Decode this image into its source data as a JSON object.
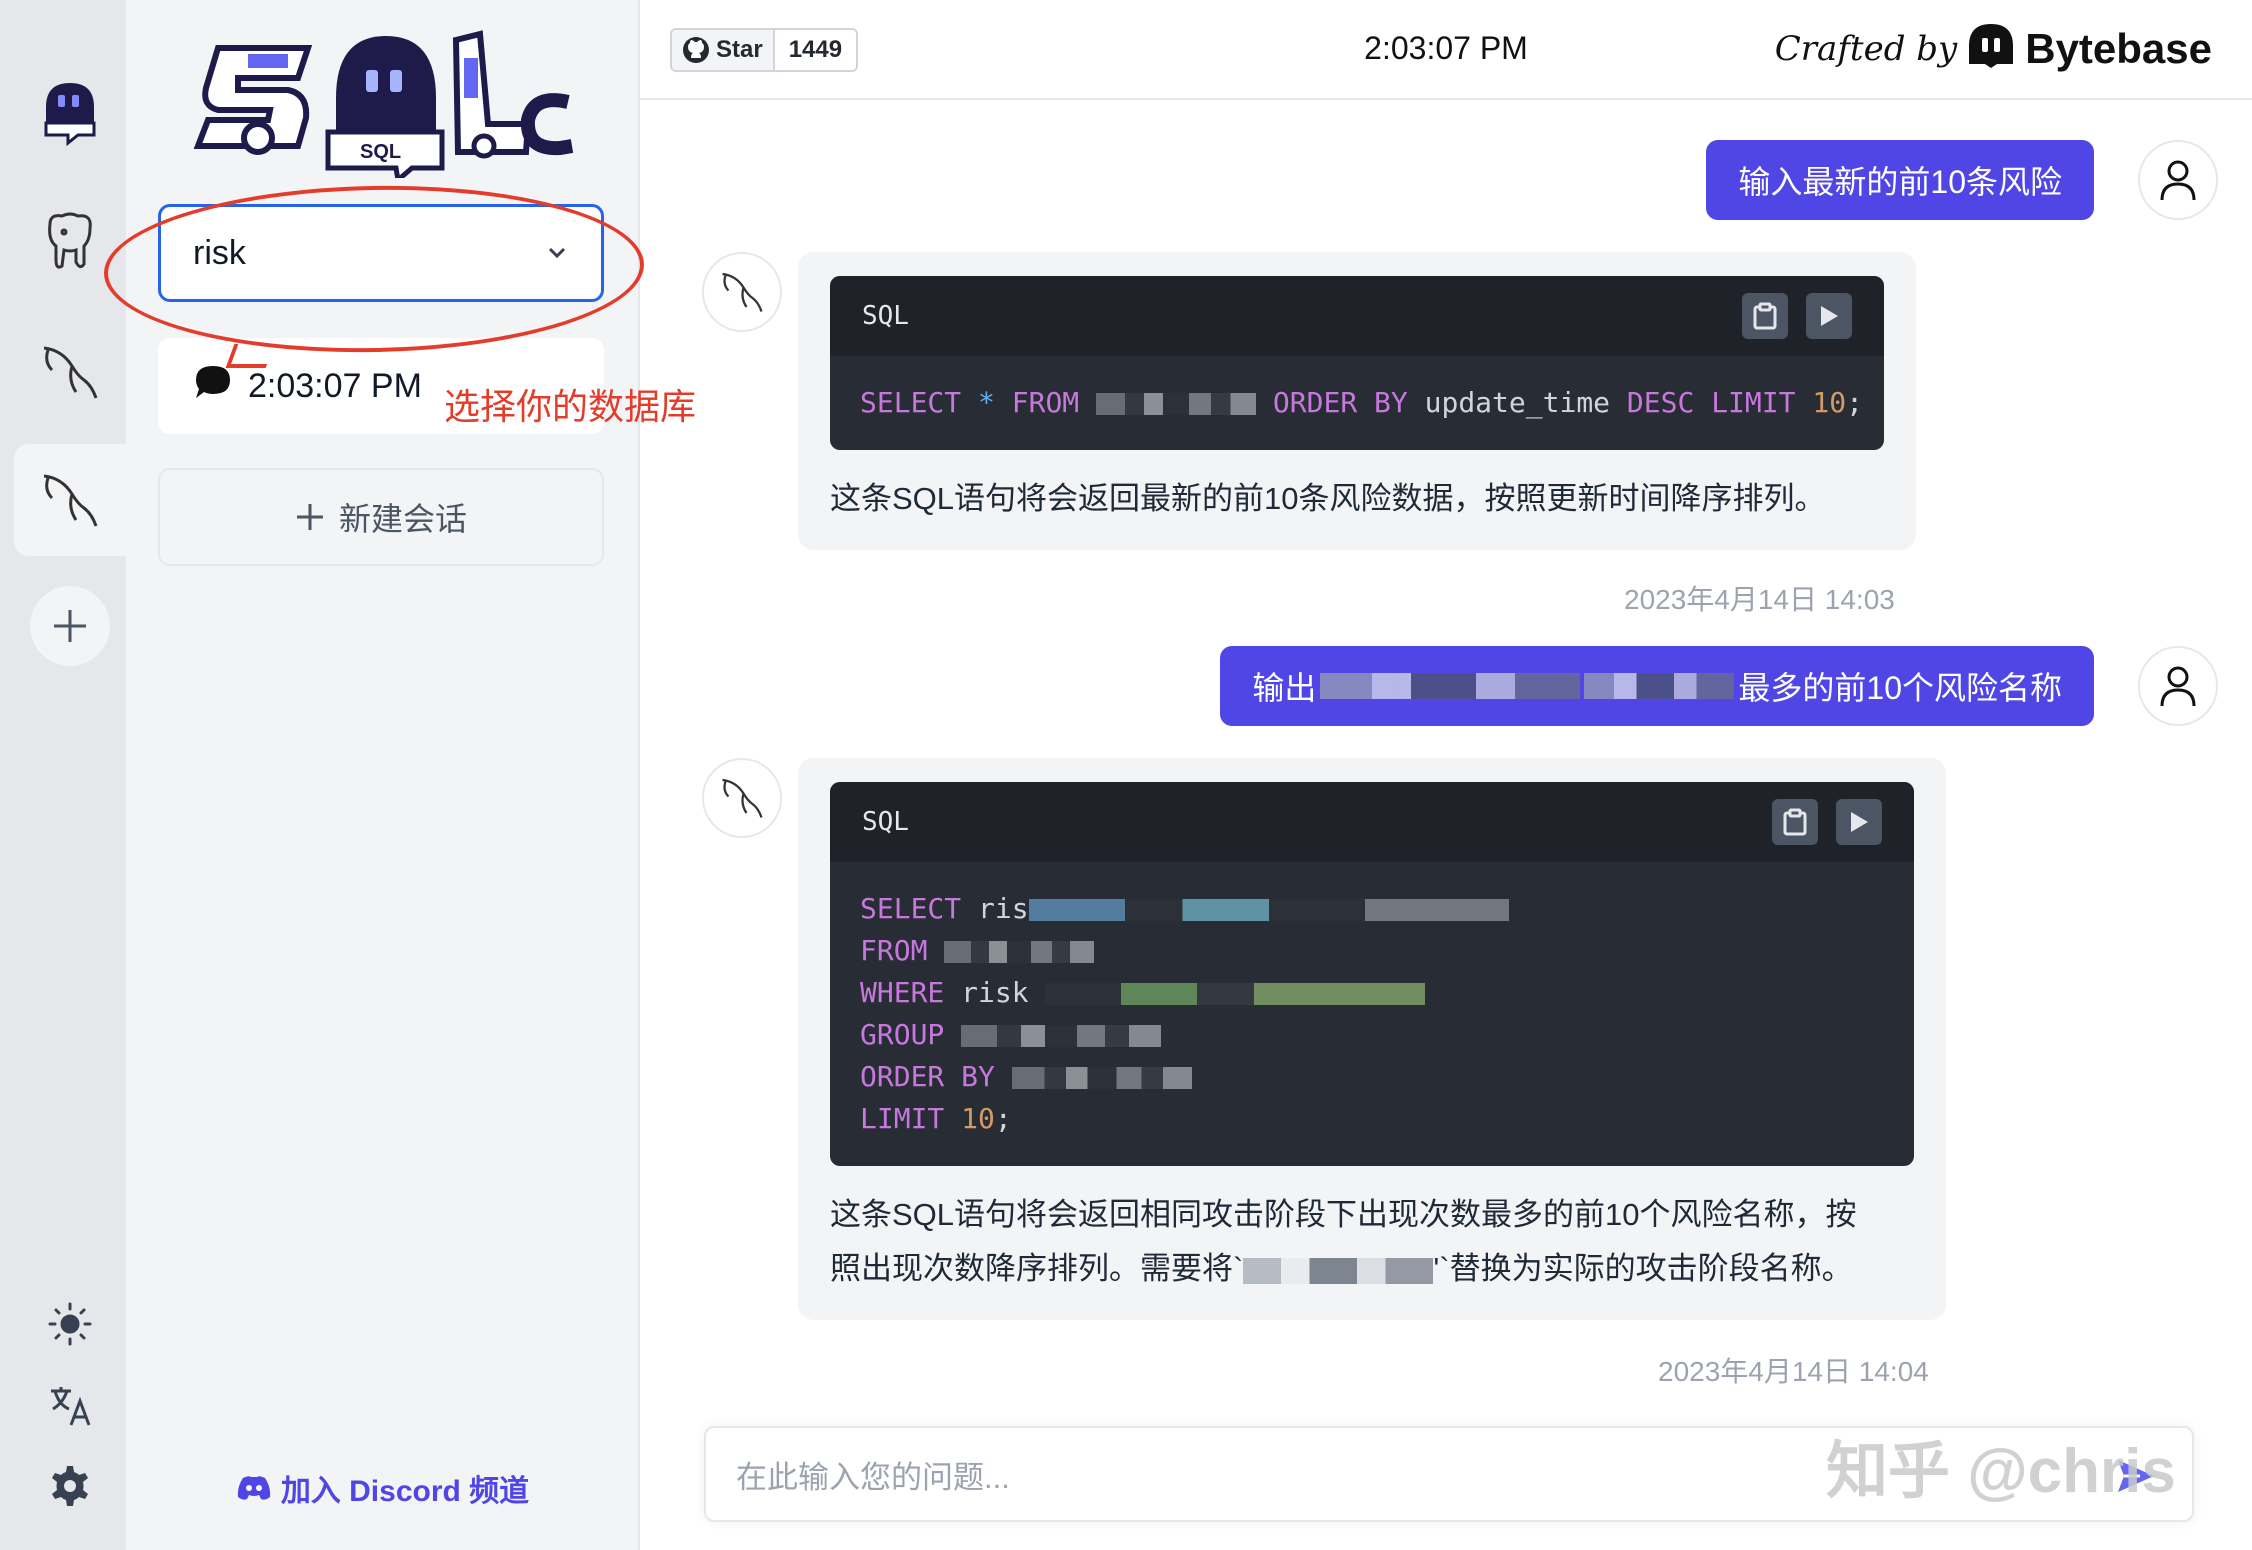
{
  "rail": {
    "icons": [
      "sql-chat-logo-icon",
      "postgresql-icon",
      "mysql-icon",
      "mysql-icon-active",
      "add-icon"
    ],
    "bottom_icons": [
      "sun-icon",
      "translate-icon",
      "gear-icon"
    ]
  },
  "sidebar": {
    "database_select_value": "risk",
    "conversations": [
      {
        "title": "2:03:07 PM"
      }
    ],
    "new_chat_label": "新建会话",
    "discord_label": "加入 Discord 频道"
  },
  "annotation": {
    "text": "选择你的数据库",
    "color": "#e33c2b"
  },
  "header": {
    "star_label": "Star",
    "star_count": "1449",
    "clock": "2:03:07 PM",
    "crafted_by": "Crafted by",
    "brand": "Bytebase"
  },
  "messages": [
    {
      "user": "输入最新的前10条风险",
      "code_lang": "SQL",
      "code_lines": {
        "l1_kw1": "SELECT",
        "l1_op": "*",
        "l1_kw2": "FROM",
        "l1_kw3": "ORDER BY",
        "l1_col": "update_time",
        "l1_kw4": "DESC",
        "l1_kw5": "LIMIT",
        "l1_num": "10",
        "l1_end": ";"
      },
      "reply": "这条SQL语句将会返回最新的前10条风险数据，按照更新时间降序排列。",
      "timestamp": "2023年4月14日 14:03"
    },
    {
      "user_prefix": "输出",
      "user_suffix": "最多的前10个风险名称",
      "code_lang": "SQL",
      "code_lines": {
        "kw_select": "SELECT",
        "select_frag": "ris",
        "kw_from": "FROM",
        "kw_where": "WHERE",
        "where_frag": "risk",
        "kw_group": "GROUP",
        "kw_order": "ORDER BY",
        "kw_limit": "LIMIT",
        "limit_num": "10",
        "limit_end": ";"
      },
      "reply_line1": "这条SQL语句将会返回相同攻击阶段下出现次数最多的前10个风险名称，按",
      "reply_line2_a": "照出现次数降序排列。需要将`",
      "reply_line2_b": "'`替换为实际的攻击阶段名称。",
      "timestamp": "2023年4月14日 14:04"
    }
  ],
  "input": {
    "placeholder": "在此输入您的问题..."
  },
  "watermark": "知乎 @chris",
  "colors": {
    "accent": "#4f46e5",
    "select_border": "#2563eb",
    "code_bg": "#282c34",
    "keyword": "#c678dd",
    "number": "#d19a66"
  }
}
